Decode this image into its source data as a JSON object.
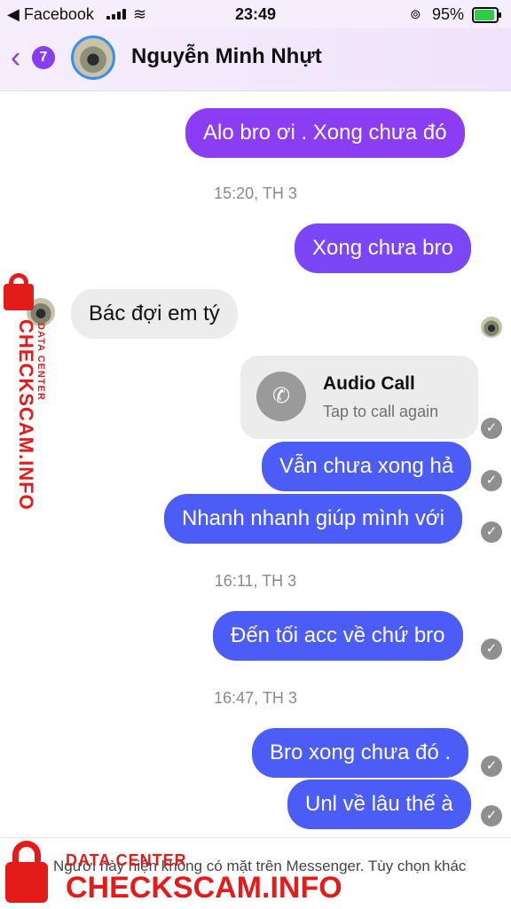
{
  "status_bar": {
    "back_app": "◀ Facebook",
    "time": "23:49",
    "battery_pct": "95%",
    "battery_level": 0.95,
    "wifi_icon": "wifi-icon",
    "lock_icon": "rotation-lock-icon",
    "lock_glyph": "⊚"
  },
  "header": {
    "back_glyph": "‹",
    "unread_count": "7",
    "contact_name": "Nguyễn Minh Nhựt"
  },
  "messages": {
    "m1": "Alo bro ơi . Xong chưa đó",
    "ts1": "15:20, TH 3",
    "m2": "Xong chưa bro",
    "m3": "Bác đợi em tý",
    "call_title": "Audio Call",
    "call_sub": "Tap to call again",
    "m4": "Vẫn chưa xong hả",
    "m5": "Nhanh nhanh giúp mình với",
    "ts2": "16:11, TH 3",
    "m6": "Đến tối acc về chứ bro",
    "ts3": "16:47, TH 3",
    "m7": "Bro xong chưa đó .",
    "m8": "Unl về lâu thế à"
  },
  "check_glyph": "✓",
  "call_icon_glyph": "✆",
  "footer": {
    "message": "Người này hiện không có mặt trên Messenger. Tùy chọn khác"
  },
  "watermark": {
    "top": "DATA CENTER",
    "brand": "CHECKSCAM.INFO",
    "color": "#e31b1b"
  },
  "colors": {
    "bubble_purple": "#8a3df2",
    "bubble_blue": "#4c5cf7",
    "incoming": "#ececec"
  }
}
